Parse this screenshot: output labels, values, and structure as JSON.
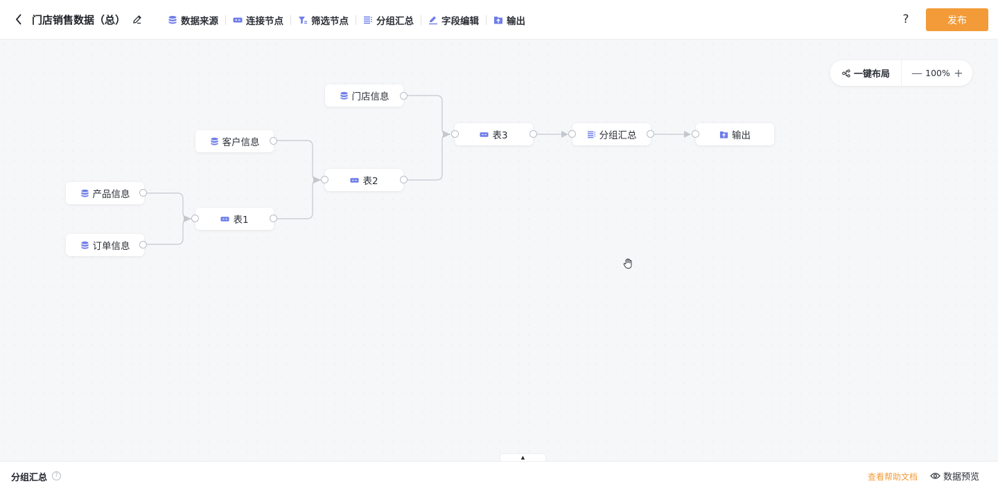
{
  "header": {
    "title": "门店销售数据（总）",
    "help_label": "?",
    "publish_label": "发布"
  },
  "toolbar": {
    "items": [
      {
        "label": "数据来源",
        "icon": "database-icon"
      },
      {
        "label": "连接节点",
        "icon": "join-icon"
      },
      {
        "label": "筛选节点",
        "icon": "filter-icon"
      },
      {
        "label": "分组汇总",
        "icon": "group-icon"
      },
      {
        "label": "字段编辑",
        "icon": "pen-icon"
      },
      {
        "label": "输出",
        "icon": "output-icon"
      }
    ]
  },
  "canvas": {
    "layout_label": "一键布局",
    "zoom_out_label": "—",
    "zoom_in_label": "+",
    "zoom_level": "100%",
    "nodes": {
      "store_info": "门店信息",
      "customer_info": "客户信息",
      "product_info": "产品信息",
      "order_info": "订单信息",
      "table1": "表1",
      "table2": "表2",
      "table3": "表3",
      "group_summary": "分组汇总",
      "output": "输出"
    }
  },
  "bottom": {
    "collapse_label": "▲",
    "title": "分组汇总",
    "info_label": "?",
    "help_link": "查看帮助文档",
    "preview_label": "数据预览"
  },
  "colors": {
    "accent": "#f29b38",
    "icon": "#6e7de8",
    "edge": "#c3c7ce"
  }
}
